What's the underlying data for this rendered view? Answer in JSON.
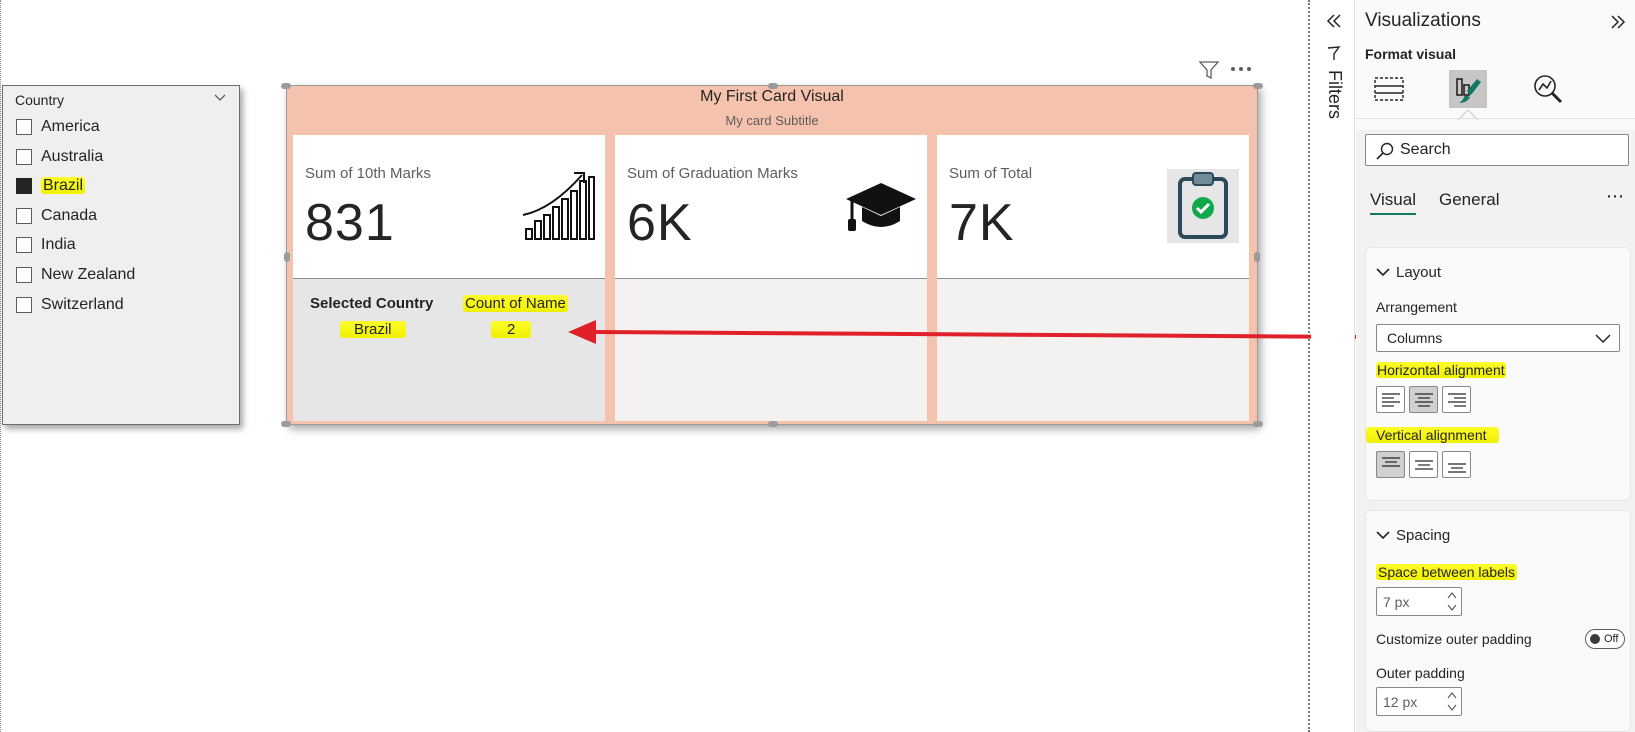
{
  "slicer": {
    "title": "Country",
    "items": [
      {
        "label": "America",
        "checked": false
      },
      {
        "label": "Australia",
        "checked": false
      },
      {
        "label": "Brazil",
        "checked": true
      },
      {
        "label": "Canada",
        "checked": false
      },
      {
        "label": "India",
        "checked": false
      },
      {
        "label": "New Zealand",
        "checked": false
      },
      {
        "label": "Switzerland",
        "checked": false
      }
    ]
  },
  "card_visual": {
    "title": "My First Card Visual",
    "subtitle": "My card Subtitle",
    "colors": {
      "background": "#f5c2ae",
      "highlight": "#f5f500",
      "arrow": "#e0202a"
    },
    "cards": [
      {
        "label": "Sum of 10th Marks",
        "value": "831",
        "icon": "growth-chart-icon"
      },
      {
        "label": "Sum of Graduation Marks",
        "value": "6K",
        "icon": "graduation-cap-icon"
      },
      {
        "label": "Sum of Total",
        "value": "7K",
        "icon": "clipboard-check-icon"
      }
    ],
    "reference": {
      "selected_country_label": "Selected Country",
      "selected_country_value": "Brazil",
      "count_label": "Count of Name",
      "count_value": "2"
    }
  },
  "filters_pane": {
    "label": "Filters"
  },
  "viz_pane": {
    "title": "Visualizations",
    "format_label": "Format visual",
    "search_placeholder": "Search",
    "tabs": [
      "Visual",
      "General"
    ],
    "layout": {
      "title": "Layout",
      "arrangement_label": "Arrangement",
      "arrangement_value": "Columns",
      "horizontal_alignment_label": "Horizontal alignment",
      "horizontal_selected": "center",
      "vertical_alignment_label": "Vertical alignment",
      "vertical_selected": "top"
    },
    "spacing": {
      "title": "Spacing",
      "space_between_label": "Space between labels",
      "space_between_value": "7 px",
      "outer_padding_toggle_label": "Customize outer padding",
      "outer_padding_toggle_state": "Off",
      "outer_padding_label": "Outer padding",
      "outer_padding_value": "12 px"
    }
  }
}
